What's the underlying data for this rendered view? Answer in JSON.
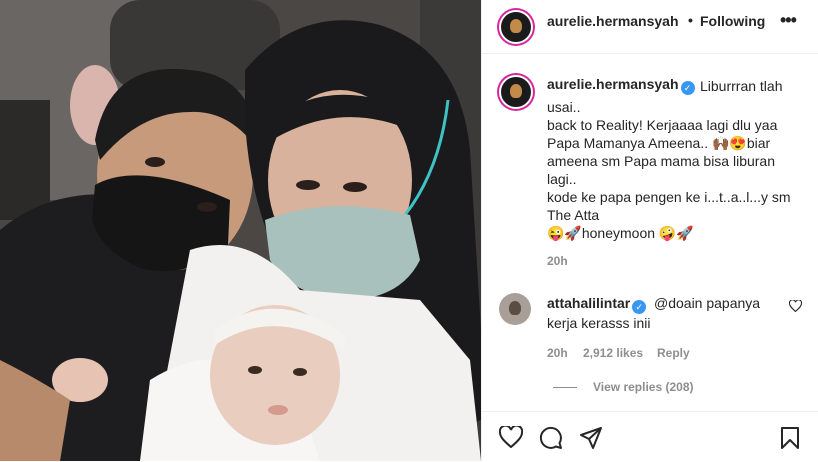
{
  "post": {
    "author": "aurelie.hermansyah",
    "follow_status": "Following",
    "separator": "•",
    "more_icon": "•••"
  },
  "caption": {
    "username": "aurelie.hermansyah",
    "verified_icon": "✓",
    "line_1": "Liburrran tlah",
    "lines": [
      "usai..",
      "back to Reality! Kerjaaaa lagi dlu yaa",
      "Papa Mamanya Ameena.. 🙌🏾😍biar",
      "ameena sm Papa mama bisa liburan",
      "lagi..",
      "kode ke papa pengen ke i...t..a..l...y sm",
      "The Atta",
      "😜🚀honeymoon 🤪🚀"
    ],
    "time": "20h"
  },
  "comment": {
    "username": "attahalilintar",
    "verified_icon": "✓",
    "text_1": "@doain papanya",
    "text_2": "kerja kerasss inii",
    "time": "20h",
    "likes": "2,912 likes",
    "reply": "Reply",
    "view_replies": "View replies (208)"
  },
  "colors": {
    "accent": "#3897f0",
    "muted": "#8e8e8e",
    "text": "#262626"
  }
}
